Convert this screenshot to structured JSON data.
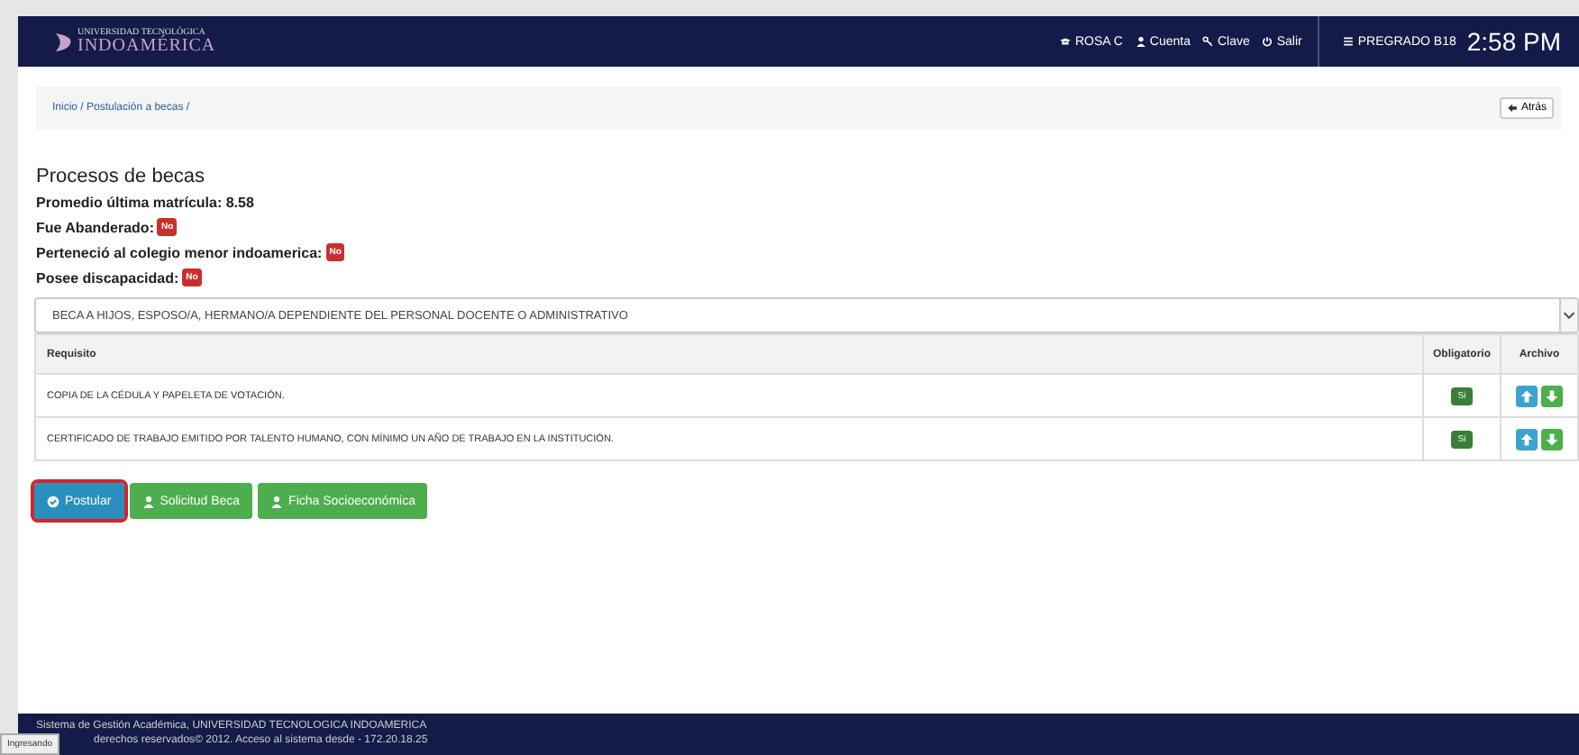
{
  "navbar": {
    "logo_top": "UNIVERSIDAD TECNOLÓGICA",
    "logo_main": "INDOAMÉRICA",
    "user": "ROSA C",
    "links": [
      {
        "kind": "account",
        "label": "Cuenta"
      },
      {
        "kind": "password",
        "label": "Clave"
      },
      {
        "kind": "logout",
        "label": "Salir"
      }
    ],
    "program": "PREGRADO B18",
    "time": "2:58 PM"
  },
  "breadcrumb": {
    "path": "Inicio / Postulación a becas /",
    "back_button": "Atrás"
  },
  "section": {
    "title": "Procesos de becas",
    "fields": [
      {
        "label": "Promedio última matrícula:",
        "value": "8.58",
        "kind": "text"
      },
      {
        "label": "Fue Abanderado:",
        "value": "No",
        "kind": "badge"
      },
      {
        "label": "Perteneció al colegio menor indoamerica:",
        "value": "No",
        "kind": "badge"
      },
      {
        "label": "Posee discapacidad:",
        "value": "No",
        "kind": "badge"
      }
    ]
  },
  "scholarship_select": {
    "value": "BECA A HIJOS, ESPOSO/A, HERMANO/A DEPENDIENTE DEL PERSONAL DOCENTE O ADMINISTRATIVO"
  },
  "table": {
    "columns": [
      "Requisito",
      "Obligatorio",
      "Archivo"
    ],
    "rows": [
      {
        "requisito": "COPIA DE LA CÉDULA Y PAPELETA DE VOTACIÓN.",
        "obligatorio": "Si"
      },
      {
        "requisito": "CERTIFICADO DE TRABAJO EMITIDO POR TALENTO HUMANO, CON MÍNIMO UN AÑO DE TRABAJO EN LA INSTITUCIÓN.",
        "obligatorio": "Si"
      }
    ]
  },
  "actions": [
    {
      "label": "Postular",
      "kind": "primary",
      "highlighted": true
    },
    {
      "label": "Solicitud Beca",
      "kind": "success",
      "highlighted": false
    },
    {
      "label": "Ficha Socioeconómica",
      "kind": "success",
      "highlighted": false
    }
  ],
  "footer": {
    "line1": "Sistema de Gestión Académica, UNIVERSIDAD TECNOLOGICA INDOAMERICA",
    "line2": "derechos reservados© 2012. Acceso al sistema desde - 172.20.18.25",
    "overlay_tag": "Ingresando"
  }
}
